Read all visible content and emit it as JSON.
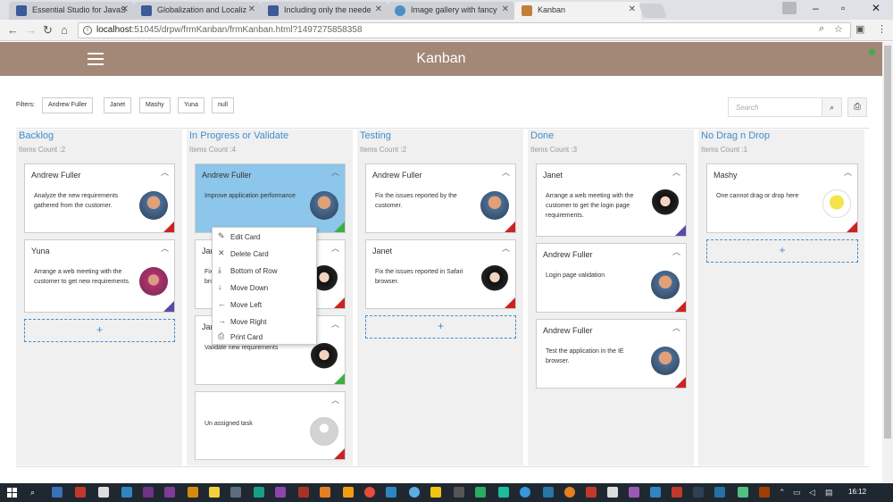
{
  "browser": {
    "tabs": [
      {
        "title": "Essential Studio for JavaS"
      },
      {
        "title": "Globalization and Localiz"
      },
      {
        "title": "Including only the neede"
      },
      {
        "title": "Image gallery with fancy"
      },
      {
        "title": "Kanban"
      }
    ],
    "url_host": "localhost",
    "url_rest": ":51045/drpw/frmKanban/frmKanban.html?1497275858358"
  },
  "app": {
    "title": "Kanban",
    "filters_label": "Filters:",
    "filters": [
      "Andrew Fuller",
      "Janet",
      "Mashy",
      "Yuna",
      "null"
    ],
    "search_placeholder": "Search"
  },
  "columns": [
    {
      "title": "Backlog",
      "count": "Items Count :2",
      "cards": [
        {
          "name": "Andrew Fuller",
          "desc": "Analyze the new requirements gathered from the customer.",
          "avatar": "andrew",
          "corner": "red"
        },
        {
          "name": "Yuna",
          "desc": "Arrange a web meeting with the customer to get new requirements.",
          "avatar": "yuna",
          "corner": "purple"
        }
      ]
    },
    {
      "title": "In Progress or Validate",
      "count": "Items Count :4",
      "cards": [
        {
          "name": "Andrew Fuller",
          "desc": "Improve application performance",
          "avatar": "andrew",
          "corner": "green"
        },
        {
          "name": "Jan",
          "desc": "Fix\nbro",
          "avatar": "janet",
          "corner": "red"
        },
        {
          "name": "Jan",
          "desc": "Validate new requirements",
          "avatar": "janet",
          "corner": "green"
        },
        {
          "name": "",
          "desc": "Un assigned task",
          "avatar": "none",
          "corner": "red"
        }
      ]
    },
    {
      "title": "Testing",
      "count": "Items Count :2",
      "cards": [
        {
          "name": "Andrew Fuller",
          "desc": "Fix the issues reported by the customer.",
          "avatar": "andrew",
          "corner": "red"
        },
        {
          "name": "Janet",
          "desc": "Fix the issues reported in Safari browser.",
          "avatar": "janet",
          "corner": "red"
        }
      ]
    },
    {
      "title": "Done",
      "count": "Items Count :3",
      "cards": [
        {
          "name": "Janet",
          "desc": "Arrange a web meeting with the customer to get the login page requirements.",
          "avatar": "janet",
          "corner": "purple"
        },
        {
          "name": "Andrew Fuller",
          "desc": "Login page validation",
          "avatar": "andrew",
          "corner": "red"
        },
        {
          "name": "Andrew Fuller",
          "desc": "Test the application in the IE browser.",
          "avatar": "andrew",
          "corner": "red"
        }
      ]
    },
    {
      "title": "No Drag n Drop",
      "count": "Items Count :1",
      "cards": [
        {
          "name": "Mashy",
          "desc": "One cannot drag or drop here",
          "avatar": "mashy",
          "corner": "red"
        }
      ]
    }
  ],
  "context_menu": [
    {
      "label": "Edit Card",
      "icon": "pencil-icon"
    },
    {
      "label": "Delete Card",
      "icon": "x-icon"
    },
    {
      "label": "Bottom of Row",
      "icon": "arrow-bottom-icon"
    },
    {
      "label": "Move Down",
      "icon": "arrow-down-icon"
    },
    {
      "label": "Move Left",
      "icon": "arrow-left-icon"
    },
    {
      "label": "Move Right",
      "icon": "arrow-right-icon"
    },
    {
      "label": "Print Card",
      "icon": "printer-icon"
    }
  ],
  "taskbar": {
    "clock": "16:12"
  },
  "colors": {
    "header": "#a38877",
    "accent": "#3f8dce",
    "selected_card": "#8cc6ea"
  }
}
